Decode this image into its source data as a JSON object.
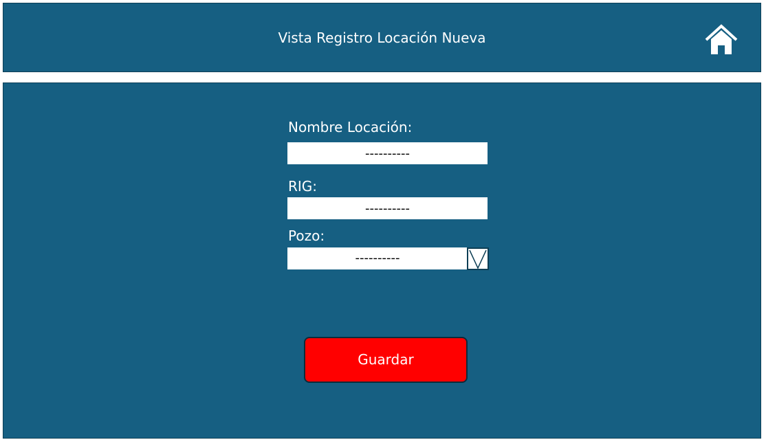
{
  "header": {
    "title": "Vista Registro Locación Nueva",
    "home_icon": "home-icon"
  },
  "form": {
    "nombre": {
      "label": "Nombre Locación:",
      "value": "----------"
    },
    "rig": {
      "label": "RIG:",
      "value": "----------"
    },
    "pozo": {
      "label": "Pozo:",
      "value": "----------",
      "toggle_icon": "chevron-down-icon"
    },
    "save_label": "Guardar"
  },
  "colors": {
    "panel": "#165f82",
    "button": "#ff0000",
    "text": "#ffffff"
  }
}
